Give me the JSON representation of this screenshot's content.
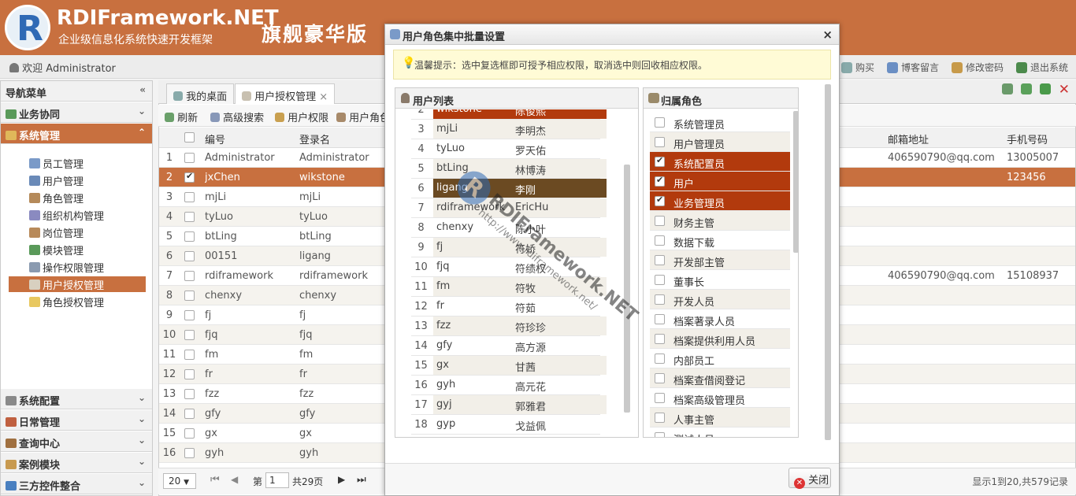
{
  "header": {
    "logo": "R",
    "brand": "RDIFramework.NET",
    "subtitle": "企业级信息化系统快速开发框架",
    "edition": "旗舰豪华版"
  },
  "welcome": "欢迎 Administrator",
  "toplinks": [
    "购买",
    "博客留言",
    "修改密码",
    "退出系统"
  ],
  "sidebar": {
    "title": "导航菜单",
    "groups_top": [
      "业务协同",
      "系统管理"
    ],
    "items": [
      "员工管理",
      "用户管理",
      "角色管理",
      "组织机构管理",
      "岗位管理",
      "模块管理",
      "操作权限管理",
      "用户授权管理",
      "角色授权管理"
    ],
    "groups_bottom": [
      "系统配置",
      "日常管理",
      "查询中心",
      "案例模块",
      "三方控件整合"
    ]
  },
  "tabs": [
    "我的桌面",
    "用户授权管理"
  ],
  "toolbar": [
    "刷新",
    "高级搜索",
    "用户权限",
    "用户角色"
  ],
  "grid": {
    "headers": {
      "code": "编号",
      "login": "登录名",
      "email": "邮箱地址",
      "mobile": "手机号码"
    },
    "rows": [
      {
        "n": "1",
        "code": "Administrator",
        "login": "Administrator",
        "email": "406590790@qq.com",
        "mobile": "13005007",
        "checked": false
      },
      {
        "n": "2",
        "code": "jxChen",
        "login": "wikstone",
        "email": "",
        "mobile": "123456",
        "checked": true
      },
      {
        "n": "3",
        "code": "mjLi",
        "login": "mjLi",
        "email": "",
        "mobile": "",
        "checked": false
      },
      {
        "n": "4",
        "code": "tyLuo",
        "login": "tyLuo",
        "email": "",
        "mobile": "",
        "checked": false
      },
      {
        "n": "5",
        "code": "btLing",
        "login": "btLing",
        "email": "",
        "mobile": "",
        "checked": false
      },
      {
        "n": "6",
        "code": "00151",
        "login": "ligang",
        "email": "",
        "mobile": "",
        "checked": false
      },
      {
        "n": "7",
        "code": "rdiframework",
        "login": "rdiframework",
        "email": "406590790@qq.com",
        "mobile": "15108937",
        "checked": false
      },
      {
        "n": "8",
        "code": "chenxy",
        "login": "chenxy",
        "email": "",
        "mobile": "",
        "checked": false
      },
      {
        "n": "9",
        "code": "fj",
        "login": "fj",
        "email": "",
        "mobile": "",
        "checked": false
      },
      {
        "n": "10",
        "code": "fjq",
        "login": "fjq",
        "email": "",
        "mobile": "",
        "checked": false
      },
      {
        "n": "11",
        "code": "fm",
        "login": "fm",
        "email": "",
        "mobile": "",
        "checked": false
      },
      {
        "n": "12",
        "code": "fr",
        "login": "fr",
        "email": "",
        "mobile": "",
        "checked": false
      },
      {
        "n": "13",
        "code": "fzz",
        "login": "fzz",
        "email": "",
        "mobile": "",
        "checked": false
      },
      {
        "n": "14",
        "code": "gfy",
        "login": "gfy",
        "email": "",
        "mobile": "",
        "checked": false
      },
      {
        "n": "15",
        "code": "gx",
        "login": "gx",
        "email": "",
        "mobile": "",
        "checked": false
      },
      {
        "n": "16",
        "code": "gyh",
        "login": "gyh",
        "email": "",
        "mobile": "",
        "checked": false
      }
    ]
  },
  "pager": {
    "size": "20",
    "page_prefix": "第",
    "page": "1",
    "total_pages": "共29页",
    "summary": "显示1到20,共579记录"
  },
  "dialog": {
    "title": "用户角色集中批量设置",
    "close": "×",
    "tip": "温馨提示：选中复选框即可授予相应权限，取消选中则回收相应权限。",
    "user_list_title": "用户列表",
    "role_title": "归属角色",
    "users": [
      {
        "n": "2",
        "a": "wikstone",
        "b": "陈俊熙",
        "state": "sel"
      },
      {
        "n": "3",
        "a": "mjLi",
        "b": "李明杰",
        "state": "alt"
      },
      {
        "n": "4",
        "a": "tyLuo",
        "b": "罗天佑",
        "state": ""
      },
      {
        "n": "5",
        "a": "btLing",
        "b": "林博涛",
        "state": "alt"
      },
      {
        "n": "6",
        "a": "ligang",
        "b": "李刚",
        "state": "hover"
      },
      {
        "n": "7",
        "a": "rdiframework",
        "b": "EricHu",
        "state": "alt"
      },
      {
        "n": "8",
        "a": "chenxy",
        "b": "陈小叶",
        "state": ""
      },
      {
        "n": "9",
        "a": "fj",
        "b": "符娇",
        "state": "alt"
      },
      {
        "n": "10",
        "a": "fjq",
        "b": "符绩权",
        "state": ""
      },
      {
        "n": "11",
        "a": "fm",
        "b": "符牧",
        "state": "alt"
      },
      {
        "n": "12",
        "a": "fr",
        "b": "符茹",
        "state": ""
      },
      {
        "n": "13",
        "a": "fzz",
        "b": "符珍珍",
        "state": "alt"
      },
      {
        "n": "14",
        "a": "gfy",
        "b": "高方源",
        "state": ""
      },
      {
        "n": "15",
        "a": "gx",
        "b": "甘茜",
        "state": "alt"
      },
      {
        "n": "16",
        "a": "gyh",
        "b": "高元花",
        "state": ""
      },
      {
        "n": "17",
        "a": "gyj",
        "b": "郭雅君",
        "state": "alt"
      },
      {
        "n": "18",
        "a": "gyp",
        "b": "戈益佩",
        "state": ""
      }
    ],
    "roles": [
      {
        "label": "系统管理员",
        "checked": false
      },
      {
        "label": "用户管理员",
        "checked": false
      },
      {
        "label": "系统配置员",
        "checked": true
      },
      {
        "label": "用户",
        "checked": true
      },
      {
        "label": "业务管理员",
        "checked": true
      },
      {
        "label": "财务主管",
        "checked": false
      },
      {
        "label": "数据下载",
        "checked": false
      },
      {
        "label": "开发部主管",
        "checked": false
      },
      {
        "label": "董事长",
        "checked": false
      },
      {
        "label": "开发人员",
        "checked": false
      },
      {
        "label": "档案著录人员",
        "checked": false
      },
      {
        "label": "档案提供利用人员",
        "checked": false
      },
      {
        "label": "内部员工",
        "checked": false
      },
      {
        "label": "档案查借阅登记",
        "checked": false
      },
      {
        "label": "档案高级管理员",
        "checked": false
      },
      {
        "label": "人事主管",
        "checked": false
      },
      {
        "label": "测试人员",
        "checked": false
      }
    ],
    "close_label": "关闭"
  },
  "watermark": {
    "text": "RDIFramework.NET",
    "url": "http://www.rdiframework.net/"
  },
  "colors": {
    "brand": "#c8703f",
    "selected_role": "#b23a0d",
    "selected_user": "#b23a0d",
    "hover_user": "#6b4a22"
  }
}
